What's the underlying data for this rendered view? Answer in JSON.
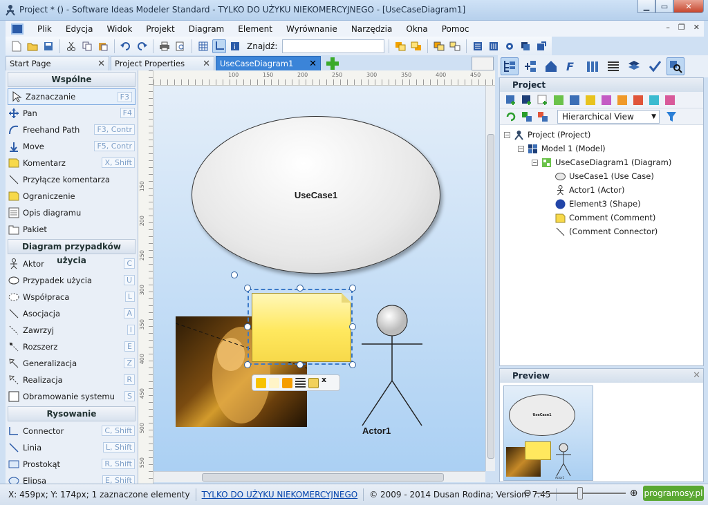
{
  "window": {
    "title": "Project *  ()  - Software Ideas Modeler Standard - TYLKO DO UŻYKU NIEKOMERCYJNEGO - [UseCaseDiagram1]"
  },
  "menu": [
    "Plik",
    "Edycja",
    "Widok",
    "Projekt",
    "Diagram",
    "Element",
    "Wyrównanie",
    "Narzędzia",
    "Okna",
    "Pomoc"
  ],
  "find": {
    "label": "Znajdź:",
    "value": ""
  },
  "tabs": [
    {
      "label": "Start Page"
    },
    {
      "label": "Project Properties"
    },
    {
      "label": "UseCaseDiagram1"
    }
  ],
  "toolbox": {
    "sections": [
      {
        "title": "Wspólne",
        "items": [
          {
            "label": "Zaznaczanie",
            "key": "F3",
            "icon": "pointer-icon"
          },
          {
            "label": "Pan",
            "key": "F4",
            "icon": "pan-icon"
          },
          {
            "label": "Freehand Path",
            "key": "F3, Contr",
            "icon": "freehand-icon"
          },
          {
            "label": "Move",
            "key": "F5, Contr",
            "icon": "move-icon"
          },
          {
            "label": "Komentarz",
            "key": "X, Shift",
            "icon": "comment-icon"
          },
          {
            "label": "Przyłącze komentarza",
            "key": "",
            "icon": "comment-connector-icon"
          },
          {
            "label": "Ograniczenie",
            "key": "",
            "icon": "constraint-icon"
          },
          {
            "label": "Opis diagramu",
            "key": "",
            "icon": "diagram-description-icon"
          },
          {
            "label": "Pakiet",
            "key": "",
            "icon": "package-icon"
          }
        ]
      },
      {
        "title": "Diagram przypadków użycia",
        "items": [
          {
            "label": "Aktor",
            "key": "C",
            "icon": "actor-icon"
          },
          {
            "label": "Przypadek użycia",
            "key": "U",
            "icon": "use-case-icon"
          },
          {
            "label": "Współpraca",
            "key": "L",
            "icon": "collaboration-icon"
          },
          {
            "label": "Asocjacja",
            "key": "A",
            "icon": "association-icon"
          },
          {
            "label": "Zawrzyj",
            "key": "I",
            "icon": "include-icon"
          },
          {
            "label": "Rozszerz",
            "key": "E",
            "icon": "extend-icon"
          },
          {
            "label": "Generalizacja",
            "key": "Z",
            "icon": "generalization-icon"
          },
          {
            "label": "Realizacja",
            "key": "R",
            "icon": "realization-icon"
          },
          {
            "label": "Obramowanie systemu",
            "key": "S",
            "icon": "system-boundary-icon"
          }
        ]
      },
      {
        "title": "Rysowanie",
        "items": [
          {
            "label": "Connector",
            "key": "C, Shift",
            "icon": "connector-icon"
          },
          {
            "label": "Linia",
            "key": "L, Shift",
            "icon": "line-icon"
          },
          {
            "label": "Prostokąt",
            "key": "R, Shift",
            "icon": "rectangle-icon"
          },
          {
            "label": "Elipsa",
            "key": "E, Shift",
            "icon": "ellipse-icon"
          }
        ]
      }
    ]
  },
  "ruler": {
    "h": [
      "100",
      "150",
      "200",
      "250",
      "300",
      "350",
      "400",
      "450"
    ],
    "v": [
      "150",
      "200",
      "250",
      "300",
      "350",
      "400",
      "450",
      "500",
      "550"
    ]
  },
  "diagram": {
    "usecase": "UseCase1",
    "actor": "Actor1"
  },
  "project_panel": {
    "title": "Project",
    "view": "Hierarchical View",
    "tree": [
      {
        "label": "Project (Project)",
        "level": 0,
        "exp": "−",
        "icon": "project-icon"
      },
      {
        "label": "Model 1 (Model)",
        "level": 1,
        "exp": "−",
        "icon": "model-icon"
      },
      {
        "label": "UseCaseDiagram1 (Diagram)",
        "level": 2,
        "exp": "−",
        "icon": "diagram-icon"
      },
      {
        "label": "UseCase1 (Use Case)",
        "level": 3,
        "exp": "",
        "icon": "use-case-icon"
      },
      {
        "label": "Actor1 (Actor)",
        "level": 3,
        "exp": "",
        "icon": "actor-icon"
      },
      {
        "label": "Element3 (Shape)",
        "level": 3,
        "exp": "",
        "icon": "shape-icon"
      },
      {
        "label": "Comment (Comment)",
        "level": 3,
        "exp": "",
        "icon": "comment-icon"
      },
      {
        "label": " (Comment Connector)",
        "level": 3,
        "exp": "",
        "icon": "connector-icon"
      }
    ]
  },
  "preview": {
    "title": "Preview",
    "usecase": "UseCase1",
    "actor": "Actor1"
  },
  "status": {
    "pos": "X: 459px; Y: 174px; 1 zaznaczone elementy",
    "license": "TYLKO DO UŻYKU NIEKOMERCYJNEGO",
    "copy": "© 2009 - 2014 Dusan Rodina; Version: 7.45"
  },
  "watermark": "programosy.pl",
  "colors": {
    "accent": "#3b84d8",
    "comment": "#ffe85e",
    "canvas": "#abd0f3"
  }
}
